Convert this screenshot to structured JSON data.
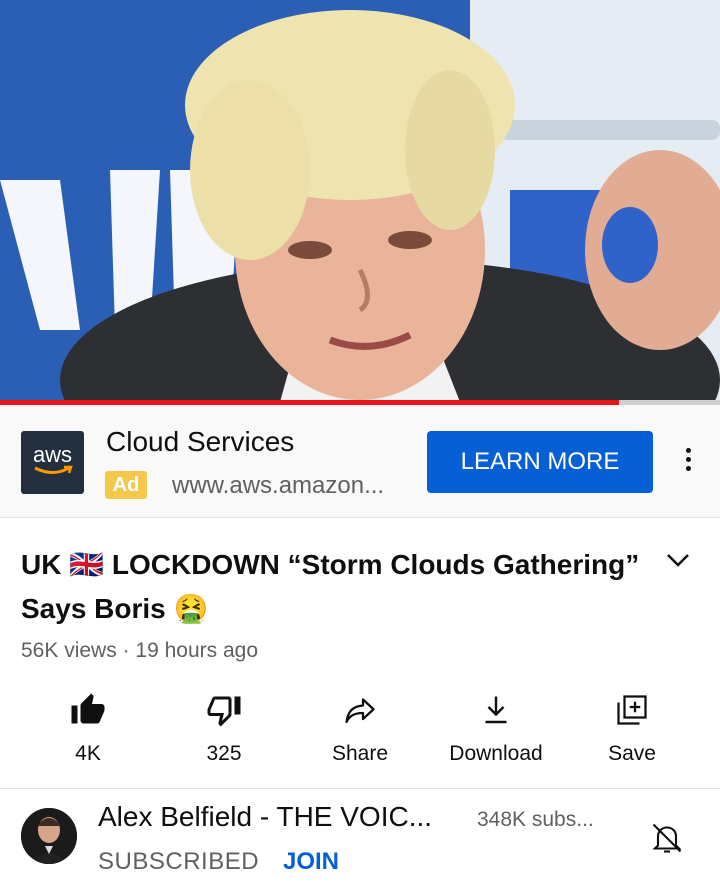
{
  "player": {
    "progress_fraction": 0.86,
    "progress_color": "#e8151b"
  },
  "ad": {
    "logo_text": "aws",
    "title": "Cloud Services",
    "badge": "Ad",
    "url": "www.aws.amazon...",
    "cta": "LEARN MORE",
    "cta_color": "#065fd4",
    "badge_color": "#f2c94c"
  },
  "video": {
    "title_part1": "UK ",
    "flag": "🇬🇧",
    "title_part2": " LOCKDOWN “Storm Clouds Gathering” Says Boris ",
    "emoji": "🤮",
    "views": "56K views",
    "separator": "·",
    "age": "19 hours ago"
  },
  "actions": {
    "like": "4K",
    "dislike": "325",
    "share": "Share",
    "download": "Download",
    "save": "Save"
  },
  "channel": {
    "name": "Alex Belfield - THE VOIC...",
    "subscribers": "348K subs...",
    "subscribed_label": "SUBSCRIBED",
    "join_label": "JOIN"
  },
  "icons": [
    "like-icon",
    "dislike-icon",
    "share-icon",
    "download-icon",
    "save-icon",
    "notifications-off-icon",
    "more-options-icon",
    "expand-icon"
  ]
}
